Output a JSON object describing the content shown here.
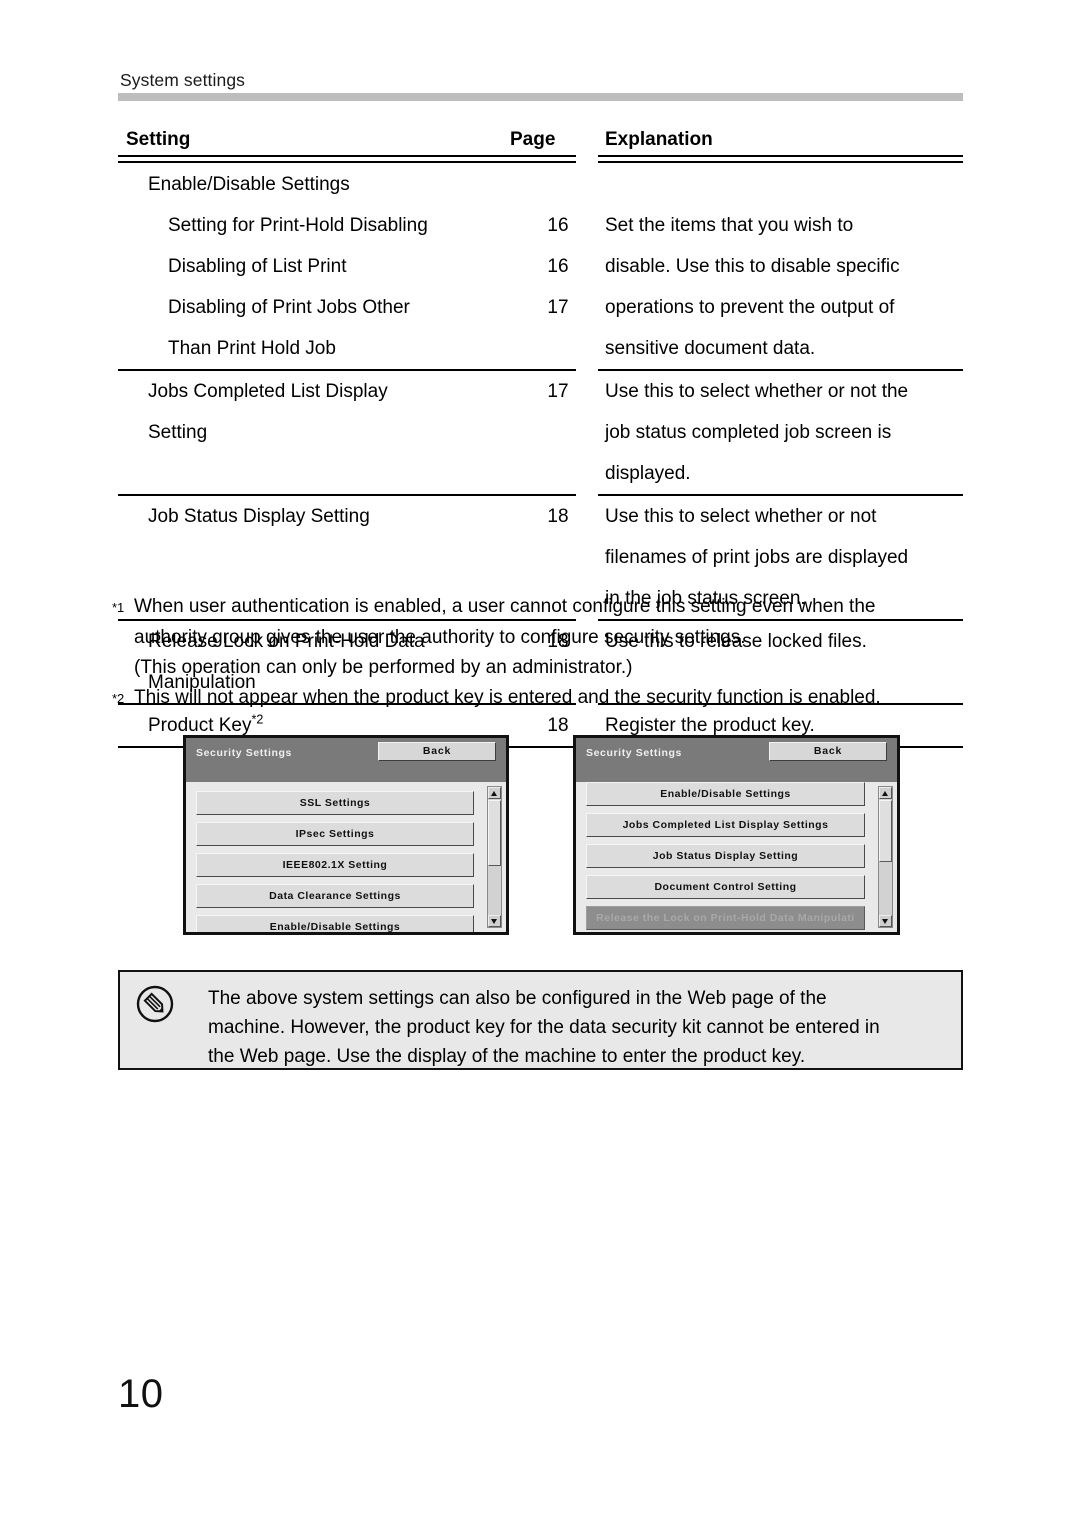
{
  "running_head": "System settings",
  "table": {
    "headers": {
      "setting": "Setting",
      "page": "Page",
      "explanation": "Explanation"
    },
    "rows": [
      {
        "setting_lines": [
          "Enable/Disable Settings",
          "Setting for Print-Hold Disabling",
          "Disabling of List Print",
          "Disabling of Print Jobs Other",
          "Than Print Hold Job"
        ],
        "pages": [
          "16",
          "16",
          "17"
        ],
        "explanation_lines": [
          "Set the items that you wish to",
          "disable. Use this to disable specific",
          "operations to prevent the output of",
          "sensitive document data."
        ]
      },
      {
        "setting_lines": [
          "Jobs Completed List Display",
          "Setting"
        ],
        "pages": [
          "17"
        ],
        "explanation_lines": [
          "Use this to select whether or not the",
          "job status completed job screen is",
          "displayed."
        ]
      },
      {
        "setting_lines": [
          "Job Status Display Setting"
        ],
        "pages": [
          "18"
        ],
        "explanation_lines": [
          "Use this to select whether or not",
          "filenames of print jobs are displayed",
          "in the job status screen."
        ]
      },
      {
        "setting_lines": [
          "Release Lock on Print-Hold Data",
          "Manipulation"
        ],
        "pages": [
          "18"
        ],
        "explanation_lines": [
          "Use this to release locked files."
        ]
      },
      {
        "setting_text": "Product Key",
        "setting_sup": "*2",
        "pages": [
          "18"
        ],
        "explanation_lines": [
          "Register the product key."
        ]
      }
    ]
  },
  "footnotes": [
    {
      "mark": "*1",
      "line1": "When user authentication is enabled, a user cannot configure this setting even when the",
      "line2": "authority group gives the user the authority to configure security settings.",
      "line3": "(This operation can only be performed by an administrator.)"
    },
    {
      "mark": "*2",
      "line1": "This will not appear when the product key is entered and the security function is enabled."
    }
  ],
  "lcd_left": {
    "title": "Security Settings",
    "back_label": "Back",
    "buttons": [
      {
        "label": "SSL Settings",
        "disabled": false
      },
      {
        "label": "IPsec Settings",
        "disabled": false
      },
      {
        "label": "IEEE802.1X Setting",
        "disabled": false
      },
      {
        "label": "Data Clearance Settings",
        "disabled": false
      },
      {
        "label": "Enable/Disable Settings",
        "disabled": false
      }
    ]
  },
  "lcd_right": {
    "title": "Security Settings",
    "back_label": "Back",
    "buttons": [
      {
        "label": "Enable/Disable Settings",
        "disabled": false
      },
      {
        "label": "Jobs Completed List Display Settings",
        "disabled": false
      },
      {
        "label": "Job Status Display Setting",
        "disabled": false
      },
      {
        "label": "Document Control Setting",
        "disabled": false
      },
      {
        "label": "Release the Lock on Print-Hold Data Manipulati",
        "disabled": true
      }
    ]
  },
  "note": {
    "line1": "The above system settings can also be configured in the Web page of the",
    "line2": "machine. However, the product key for the data security kit cannot be entered in",
    "line3": "the Web page. Use the display of the machine to enter the product key."
  },
  "folio": "10"
}
